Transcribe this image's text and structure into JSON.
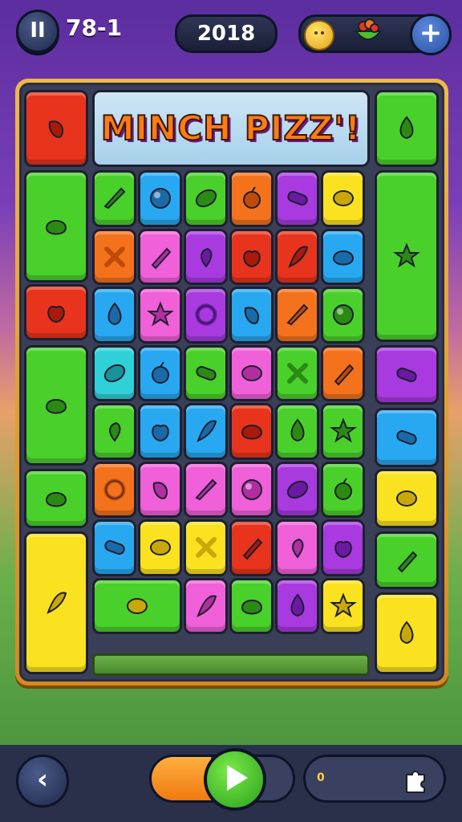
{
  "hud": {
    "pause_label": "II",
    "level": "78-1",
    "score": "2018",
    "plus_label": "+"
  },
  "banner": {
    "title": "MINCH PIZZ'!"
  },
  "board": {
    "tiles": [
      {
        "name": "tile-fruit-bag",
        "color": "#e8341c",
        "icon": "bag-icon"
      },
      {
        "name": "tile-peach",
        "color": "#4ad02a",
        "icon": "peach-icon"
      },
      {
        "name": "tile-book",
        "color": "#4ad02a",
        "icon": "book-icon"
      },
      {
        "name": "tile-spray",
        "color": "#4ad02a",
        "icon": "spray-bottle-icon"
      },
      {
        "name": "tile-red-blob",
        "color": "#e8341c",
        "icon": "blob-icon"
      },
      {
        "name": "tile-yellow-blob",
        "color": "#4ad02a",
        "icon": "blob-icon"
      },
      {
        "name": "tile-grapes",
        "color": "#4ad02a",
        "icon": "grape-icon"
      },
      {
        "name": "tile-green-blob",
        "color": "#4ad02a",
        "icon": "blob-icon"
      },
      {
        "name": "tile-marker",
        "color": "#fae220",
        "icon": "marker-icon"
      },
      {
        "name": "tile-jar-pink",
        "color": "#fae220",
        "icon": "jar-icon"
      }
    ]
  },
  "bottom": {
    "back_label": "‹",
    "progress_fraction": 0.42,
    "info_text": "0"
  },
  "colors": {
    "orange": "#f4721c",
    "red": "#e8341c",
    "green": "#4ad02a",
    "blue": "#28a8f0",
    "purple": "#a83ae0",
    "pink": "#f060d8",
    "yellow": "#fae220",
    "teal": "#30d0d8"
  }
}
